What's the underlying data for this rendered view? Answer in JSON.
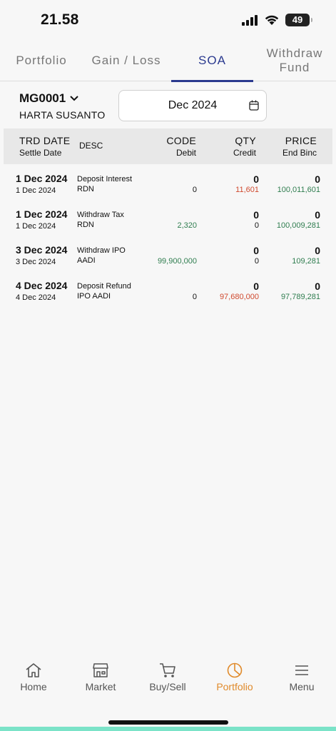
{
  "status": {
    "time": "21.58",
    "battery": "49"
  },
  "tabs": [
    {
      "label": "Portfolio",
      "active": false
    },
    {
      "label": "Gain / Loss",
      "active": false
    },
    {
      "label": "SOA",
      "active": true
    },
    {
      "label": "Withdraw Fund",
      "active": false
    }
  ],
  "account": {
    "code": "MG0001",
    "name": "HARTA SUSANTO"
  },
  "date_filter": {
    "value": "Dec 2024"
  },
  "table": {
    "headers": {
      "trd_date": "TRD DATE",
      "settle_date": "Settle Date",
      "desc": "DESC",
      "code": "CODE",
      "debit": "Debit",
      "qty": "QTY",
      "credit": "Credit",
      "price": "PRICE",
      "end_binc": "End Binc"
    },
    "rows": [
      {
        "trd_date": "1 Dec 2024",
        "settle_date": "1 Dec 2024",
        "desc1": "Deposit Interest",
        "desc2": "RDN",
        "code": "",
        "debit": "0",
        "qty": "0",
        "credit": "11,601",
        "price": "0",
        "end_binc": "100,011,601",
        "debit_color": "plain",
        "credit_color": "red"
      },
      {
        "trd_date": "1 Dec 2024",
        "settle_date": "1 Dec 2024",
        "desc1": "Withdraw Tax",
        "desc2": "RDN",
        "code": "",
        "debit": "2,320",
        "qty": "0",
        "credit": "0",
        "price": "0",
        "end_binc": "100,009,281",
        "debit_color": "green",
        "credit_color": "plain"
      },
      {
        "trd_date": "3 Dec 2024",
        "settle_date": "3 Dec 2024",
        "desc1": "Withdraw IPO",
        "desc2": "AADI",
        "code": "",
        "debit": "99,900,000",
        "qty": "0",
        "credit": "0",
        "price": "0",
        "end_binc": "109,281",
        "debit_color": "green",
        "credit_color": "plain"
      },
      {
        "trd_date": "4 Dec 2024",
        "settle_date": "4 Dec 2024",
        "desc1": "Deposit Refund",
        "desc2": "IPO AADI",
        "code": "",
        "debit": "0",
        "qty": "0",
        "credit": "97,680,000",
        "price": "0",
        "end_binc": "97,789,281",
        "debit_color": "plain",
        "credit_color": "red"
      }
    ]
  },
  "bottom_nav": [
    {
      "label": "Home",
      "icon": "home-icon",
      "active": false
    },
    {
      "label": "Market",
      "icon": "market-icon",
      "active": false
    },
    {
      "label": "Buy/Sell",
      "icon": "cart-icon",
      "active": false
    },
    {
      "label": "Portfolio",
      "icon": "pie-chart-icon",
      "active": true
    },
    {
      "label": "Menu",
      "icon": "hamburger-icon",
      "active": false
    }
  ],
  "colors": {
    "accent": "#2b3a8f",
    "nav_active": "#e08a2a",
    "positive": "#2f7d4f",
    "negative": "#d04a2f"
  }
}
